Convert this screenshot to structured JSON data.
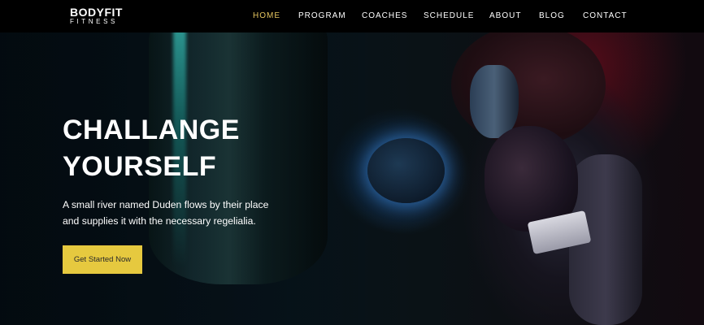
{
  "brand": {
    "name": "BODYFIT",
    "sub": "FITNESS"
  },
  "nav": {
    "items": [
      {
        "label": "HOME",
        "active": true
      },
      {
        "label": "PROGRAM",
        "active": false
      },
      {
        "label": "COACHES",
        "active": false
      },
      {
        "label": "SCHEDULE",
        "active": false
      },
      {
        "label": "ABOUT",
        "active": false
      },
      {
        "label": "BLOG",
        "active": false
      },
      {
        "label": "CONTACT",
        "active": false
      }
    ],
    "active_color": "#e5c55f"
  },
  "hero": {
    "title_line1": "CHALLANGE",
    "title_line2": "YOURSELF",
    "text": "A small river named Duden flows by their place and supplies it with the necessary regelialia.",
    "cta_label": "Get Started Now",
    "cta_color": "#e6c93f"
  }
}
